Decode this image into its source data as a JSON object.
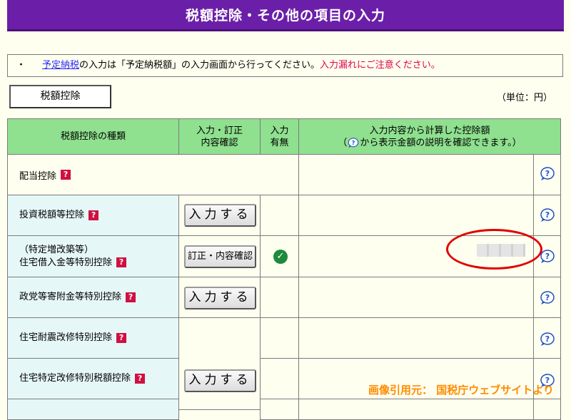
{
  "header": {
    "title": "税額控除・その他の項目の入力"
  },
  "notice": {
    "bullet": "・",
    "link": "予定納税",
    "text": "の入力は「予定納税額」の入力画面から行ってください。",
    "warning": "入力漏れにご注意ください。"
  },
  "tab": {
    "label": "税額控除"
  },
  "unit": "（単位：円）",
  "table": {
    "headers": {
      "type": "税額控除の種類",
      "entry": "入力・訂正\n内容確認",
      "status": "入力\n有無",
      "amount_line1": "入力内容から計算した控除額",
      "amount_line2_before": "（",
      "amount_line2_after": "から表示金額の説明を確認できます。）"
    },
    "rows": [
      {
        "label": "配当控除",
        "button": "",
        "status": ""
      },
      {
        "label": "投資税額等控除",
        "button": "入力する",
        "status": ""
      },
      {
        "label_line1": "（特定増改築等）",
        "label": "住宅借入金等特別控除",
        "button": "訂正・内容確認",
        "status": "check"
      },
      {
        "label": "政党等寄附金等特別控除",
        "button": "入力する",
        "status": ""
      },
      {
        "label": "住宅耐震改修特別控除",
        "button": "",
        "status": ""
      },
      {
        "label": "住宅特定改修特別税額控除",
        "button": "入力する",
        "status": ""
      }
    ],
    "help_glyph": "?",
    "info_glyph": "?"
  },
  "credit": "画像引用元： 国税庁ウェブサイトより",
  "colors": {
    "title": "#6b1fa8",
    "header": "#8fe08f",
    "label_bg": "#e6f7f7",
    "warning": "#e0004a",
    "credit": "#ff8c00"
  }
}
